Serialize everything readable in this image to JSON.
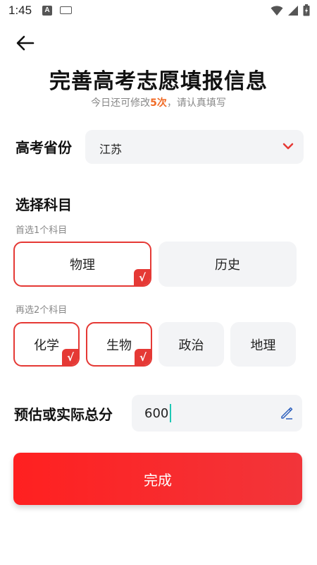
{
  "status_bar": {
    "time": "1:45",
    "notification_icon": "A"
  },
  "header": {
    "title": "完善高考志愿填报信息",
    "subtitle_prefix": "今日还可修改",
    "subtitle_count": "5次",
    "subtitle_suffix": "，请认真填写"
  },
  "province": {
    "label": "高考省份",
    "value": "江苏"
  },
  "subjects": {
    "label": "选择科目",
    "group1": {
      "label": "首选1个科目",
      "options": [
        {
          "label": "物理",
          "selected": true
        },
        {
          "label": "历史",
          "selected": false
        }
      ]
    },
    "group2": {
      "label": "再选2个科目",
      "options": [
        {
          "label": "化学",
          "selected": true
        },
        {
          "label": "生物",
          "selected": true
        },
        {
          "label": "政治",
          "selected": false
        },
        {
          "label": "地理",
          "selected": false
        }
      ]
    },
    "check_mark": "√"
  },
  "score": {
    "label": "预估或实际总分",
    "value": "600"
  },
  "submit": {
    "label": "完成"
  },
  "colors": {
    "accent": "#e53935",
    "highlight": "#f06a25",
    "caret": "#1ec8b4",
    "button_start": "#ff2020",
    "button_end": "#f2353a"
  },
  "icons": {
    "back": "arrow-left-icon",
    "dropdown": "chevron-down-icon",
    "edit": "pencil-icon"
  }
}
